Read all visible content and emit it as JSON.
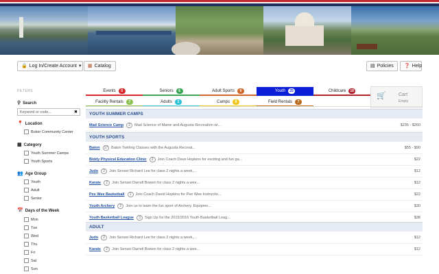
{
  "toolbar": {
    "account_label": "Log In/Create Account",
    "catalog_label": "Catalog",
    "policies_label": "Policies",
    "help_label": "Help"
  },
  "sidebar": {
    "title": "FILTERS",
    "search": {
      "label": "Search",
      "placeholder": "Keyword or code..."
    },
    "location": {
      "label": "Location",
      "options": [
        "Buker Community Center"
      ]
    },
    "category": {
      "label": "Category",
      "options": [
        "Youth Summer Camps",
        "Youth Sports"
      ]
    },
    "age_group": {
      "label": "Age Group",
      "options": [
        "Youth",
        "Adult",
        "Senior"
      ]
    },
    "days": {
      "label": "Days of the Week",
      "options": [
        "Mon",
        "Tue",
        "Wed",
        "Thu",
        "Fri",
        "Sat",
        "Sun"
      ]
    }
  },
  "tabs_row1": [
    {
      "label": "Events",
      "count": "0",
      "color": "#d9262c"
    },
    {
      "label": "Seniors",
      "count": "6",
      "color": "#3aa655"
    },
    {
      "label": "Adult Sports",
      "count": "9",
      "color": "#d0662a"
    },
    {
      "label": "Youth",
      "count": "25",
      "color": "#ffffff",
      "active": true
    },
    {
      "label": "Childcare",
      "count": "18",
      "color": "#b0212a"
    }
  ],
  "tabs_row2": [
    {
      "label": "Facility Rentals",
      "count": "7",
      "color": "#8cc152"
    },
    {
      "label": "Adults",
      "count": "3",
      "color": "#2ac3d4"
    },
    {
      "label": "Camps",
      "count": "8",
      "color": "#f0c419"
    },
    {
      "label": "Field Rentals",
      "count": "7",
      "color": "#b86b1e"
    }
  ],
  "cart": {
    "label": "Cart",
    "status": "Empty"
  },
  "sections": [
    {
      "title": "YOUTH SUMMER CAMPS",
      "rows": [
        {
          "name": "Mad Science Camp",
          "count": "2",
          "desc": "Mad Science of Maine and Augusta Recreation wi...",
          "price": "$235 - $260"
        }
      ]
    },
    {
      "title": "YOUTH SPORTS",
      "rows": [
        {
          "name": "Baton",
          "count": "17",
          "desc": "Baton Twirling Classes with the Augusta Recreat...",
          "price": "$55 - $90"
        },
        {
          "name": "Biddy Physical Education Clinic",
          "count": "2",
          "desc": "Join Coach Dave Hopkins for exciting and fun ga...",
          "price": "$22"
        },
        {
          "name": "Judo",
          "count": "2",
          "desc": "Join Sensei Richard Lee for class 2 nights a week,...",
          "price": "$12"
        },
        {
          "name": "Karate",
          "count": "2",
          "desc": "Join Sensei Darrell Bowen for class 2 nights a wee...",
          "price": "$12"
        },
        {
          "name": "Pee Wee Basketball",
          "count": "1",
          "desc": "Join Coach David Hopkins for Pee Wee Instructio...",
          "price": "$22"
        },
        {
          "name": "Youth Archery",
          "count": "2",
          "desc": "Join us to learn the fun sport of Archery. Equipmo...",
          "price": "$30"
        },
        {
          "name": "Youth Basketball League",
          "count": "3",
          "desc": "Sign Up for the 2015/2016 Youth Basketball Leag...",
          "price": "$38"
        }
      ]
    },
    {
      "title": "ADULT",
      "rows": [
        {
          "name": "Judo",
          "count": "2",
          "desc": "Join Sensei Richard Lee for class 2 nights a week,...",
          "price": "$12"
        },
        {
          "name": "Karate",
          "count": "2",
          "desc": "Join Sensei Darrell Bowen for class 2 nights a wee...",
          "price": "$12"
        }
      ]
    }
  ]
}
